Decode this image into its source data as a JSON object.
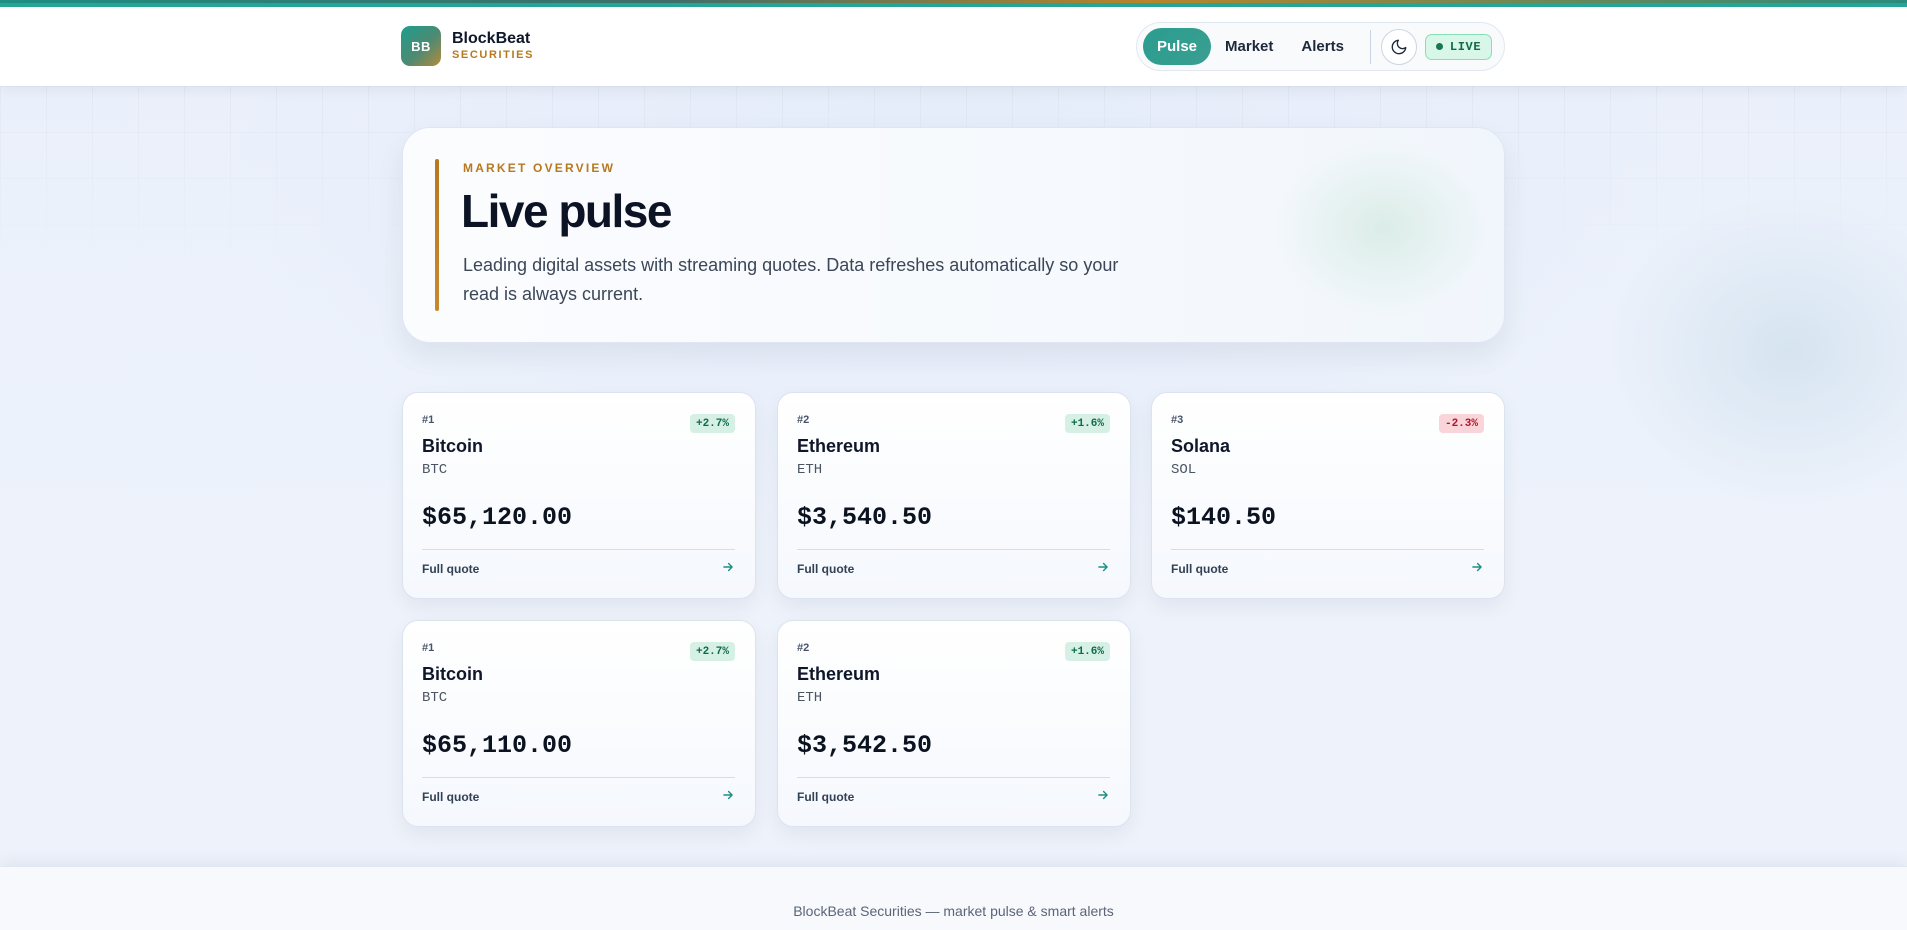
{
  "brand": {
    "logo_text": "BB",
    "name": "BlockBeat",
    "sub": "SECURITIES"
  },
  "nav": {
    "items": [
      {
        "label": "Pulse",
        "active": true
      },
      {
        "label": "Market",
        "active": false
      },
      {
        "label": "Alerts",
        "active": false
      }
    ],
    "theme_icon": "moon-icon",
    "live_label": "LIVE"
  },
  "hero": {
    "eyebrow": "MARKET OVERVIEW",
    "title": "Live pulse",
    "description": "Leading digital assets with streaming quotes. Data refreshes automatically so your read is always current."
  },
  "cards": [
    {
      "rank": "#1",
      "change": "+2.7%",
      "direction": "up",
      "name": "Bitcoin",
      "symbol": "BTC",
      "price": "$65,120.00",
      "link": "Full quote"
    },
    {
      "rank": "#2",
      "change": "+1.6%",
      "direction": "up",
      "name": "Ethereum",
      "symbol": "ETH",
      "price": "$3,540.50",
      "link": "Full quote"
    },
    {
      "rank": "#3",
      "change": "-2.3%",
      "direction": "down",
      "name": "Solana",
      "symbol": "SOL",
      "price": "$140.50",
      "link": "Full quote"
    },
    {
      "rank": "#1",
      "change": "+2.7%",
      "direction": "up",
      "name": "Bitcoin",
      "symbol": "BTC",
      "price": "$65,110.00",
      "link": "Full quote"
    },
    {
      "rank": "#2",
      "change": "+1.6%",
      "direction": "up",
      "name": "Ethereum",
      "symbol": "ETH",
      "price": "$3,542.50",
      "link": "Full quote"
    }
  ],
  "footer": {
    "text": "BlockBeat Securities — market pulse & smart alerts"
  },
  "colors": {
    "accent": "#2a9d8f",
    "gold": "#b7791f",
    "up": "#0e6b48",
    "down": "#b4122b"
  }
}
